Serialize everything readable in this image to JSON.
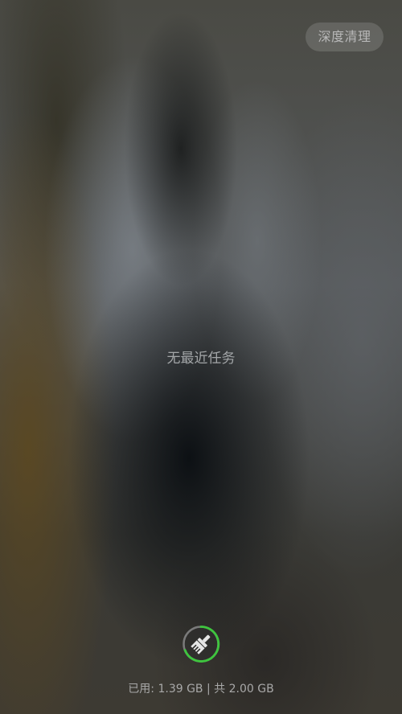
{
  "header": {
    "deep_clean_label": "深度清理"
  },
  "recents": {
    "empty_text": "无最近任务"
  },
  "clean_button": {
    "icon": "broom-icon",
    "ring_color": "#3ec53e"
  },
  "memory": {
    "status_text": "已用: 1.39 GB | 共 2.00 GB"
  }
}
